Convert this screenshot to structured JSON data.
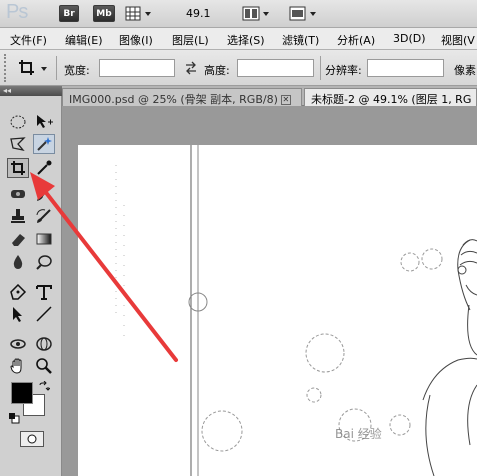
{
  "app": {
    "logo": "Ps",
    "bridge_label": "Br",
    "minibridge_label": "Mb",
    "zoom": "49.1"
  },
  "menu": [
    "文件(F)",
    "编辑(E)",
    "图像(I)",
    "图层(L)",
    "选择(S)",
    "滤镜(T)",
    "分析(A)",
    "3D(D)",
    "视图(V"
  ],
  "options": {
    "width_label": "宽度:",
    "width_value": "",
    "height_label": "高度:",
    "height_value": "",
    "resolution_label": "分辨率:",
    "resolution_value": "",
    "unit_label": "像素"
  },
  "tabs": [
    {
      "label": "IMG000.psd @ 25% (骨架 副本, RGB/8)",
      "active": false
    },
    {
      "label": "未标题-2 @ 49.1% (图层 1, RG",
      "active": true
    }
  ],
  "toolbox": {
    "selected_tool": "crop-tool",
    "foreground_color": "#000000",
    "background_color": "#ffffff"
  },
  "annotation": {
    "arrow_color": "#e83a3a"
  },
  "watermark": "Bai 经验"
}
